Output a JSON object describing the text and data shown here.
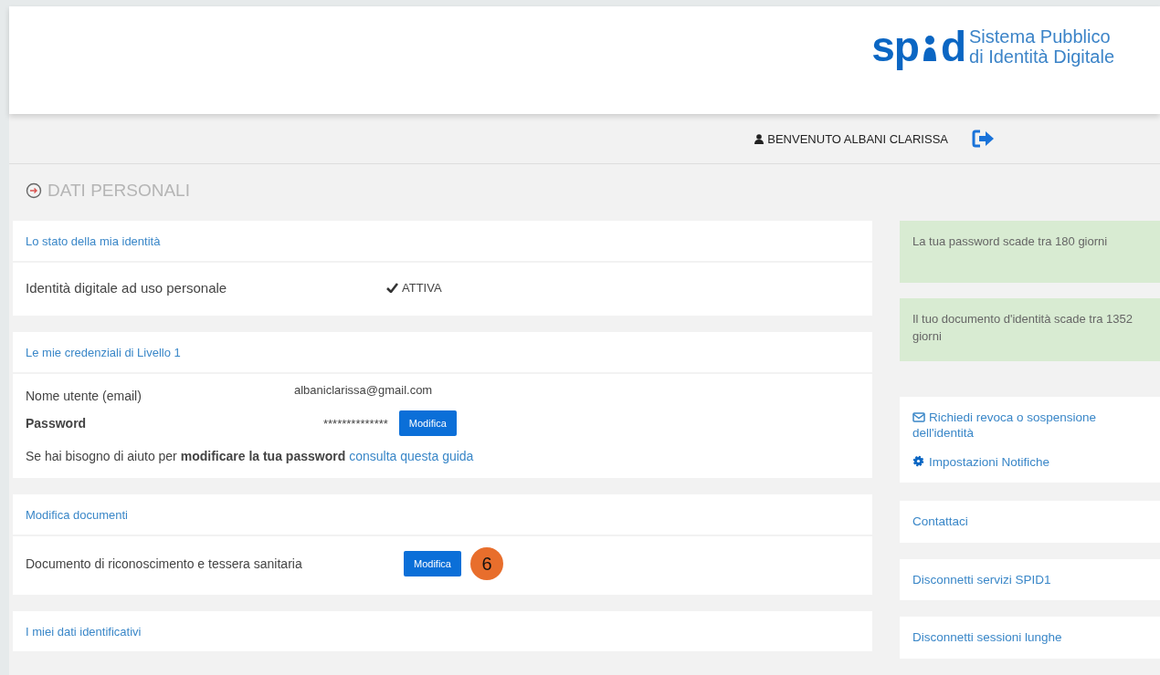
{
  "logo": {
    "wordmark_before": "sp",
    "wordmark_after": "d",
    "tagline": [
      "Sistema Pubblico",
      "di Identità Digitale"
    ]
  },
  "user_bar": {
    "welcome": "BENVENUTO ALBANI CLARISSA"
  },
  "page_title": "DATI PERSONALI",
  "cards": [
    {
      "title": "Lo stato della mia identità",
      "rows": [
        {
          "kind": "status",
          "label": "Identità digitale ad uso personale",
          "value": "ATTIVA"
        }
      ]
    },
    {
      "title": "Le mie credenziali di Livello 1",
      "rows": [
        {
          "kind": "field",
          "label": "Nome utente (email)",
          "value": "albaniclarissa@gmail.com"
        },
        {
          "kind": "password",
          "label": "Password",
          "value": "**************",
          "button": "Modifica"
        },
        {
          "kind": "help",
          "text": "Se hai bisogno di aiuto per **modificare la tua password**",
          "link": "consulta questa guida"
        }
      ]
    },
    {
      "title": "Modifica documenti",
      "rows": [
        {
          "kind": "action",
          "label": "Documento di riconoscimento e tessera sanitaria",
          "button": "Modifica",
          "badge": "6"
        }
      ]
    },
    {
      "title": "I miei dati identificativi"
    }
  ],
  "notices": [
    "La tua password scade tra 180 giorni",
    "Il tuo documento d'identità scade tra 1352 giorni"
  ],
  "action_links": [
    {
      "kind": "mail",
      "label": "Richiedi revoca o sospensione dell'identità"
    },
    {
      "kind": "gear",
      "label": "Impostazioni Notifiche"
    }
  ],
  "link_cards": [
    "Contattaci",
    "Disconnetti servizi SPID1",
    "Disconnetti sessioni lunghe"
  ]
}
